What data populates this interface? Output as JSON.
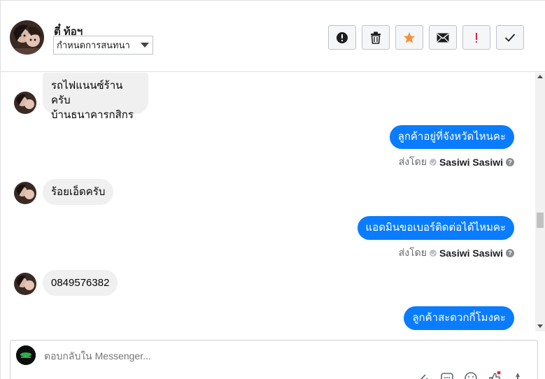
{
  "header": {
    "contact_name": "ตี๋ ท้อฯ",
    "assign_label": "กำหนดการสนทนา",
    "actions": [
      {
        "name": "spam-button",
        "icon": "alert-circle-icon"
      },
      {
        "name": "delete-button",
        "icon": "trash-icon"
      },
      {
        "name": "star-button",
        "icon": "star-icon"
      },
      {
        "name": "unread-button",
        "icon": "envelope-icon"
      },
      {
        "name": "follow-up-button",
        "icon": "exclamation-icon"
      },
      {
        "name": "done-button",
        "icon": "check-icon"
      }
    ]
  },
  "messages": [
    {
      "dir": "in",
      "text_line1": "รถไฟแนนซ์ร้านครับ",
      "text_line2": "บ้านธนาคารกสิกร"
    },
    {
      "dir": "out",
      "text": "ลูกค้าอยู่ที่จังหวัดไหนคะ",
      "sent_by_prefix": "ส่งโดย",
      "sent_by_name": "Sasiwi Sasiwi"
    },
    {
      "dir": "in",
      "text": "ร้อยเอ็ดครับ"
    },
    {
      "dir": "out",
      "text": "แอดมินขอเบอร์ติดต่อได้ไหมคะ",
      "sent_by_prefix": "ส่งโดย",
      "sent_by_name": "Sasiwi Sasiwi"
    },
    {
      "dir": "in",
      "text": "0849576382"
    },
    {
      "dir": "out",
      "text": "ลูกค้าสะดวกกี่โมงคะ"
    }
  ],
  "composer": {
    "placeholder": "ตอบกลับใน Messenger..."
  },
  "colors": {
    "outgoing_bubble": "#0a7cff",
    "incoming_bubble": "#f0f0f0",
    "star": "#f7923a",
    "follow_up": "#e41e3f"
  }
}
